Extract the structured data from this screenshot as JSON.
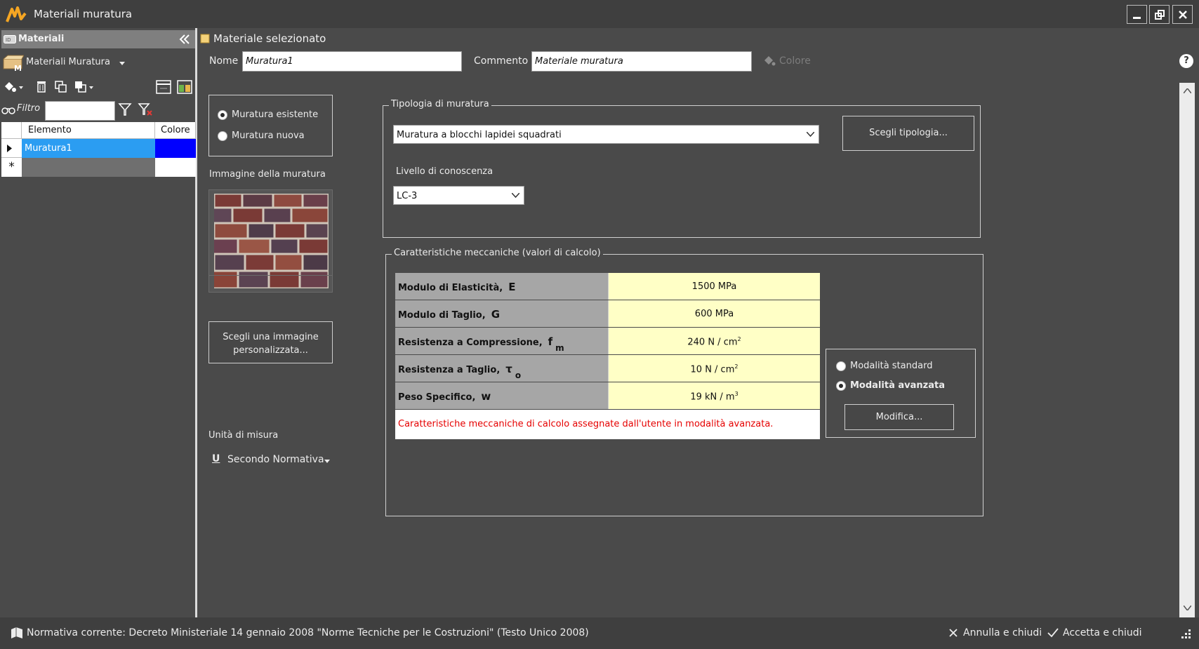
{
  "window": {
    "title": "Materiali muratura"
  },
  "left_panel": {
    "header": "Materiali",
    "library_label": "Materiali Muratura",
    "filter_label": "Filtro",
    "filter_value": "",
    "grid": {
      "columns": [
        "Elemento",
        "Colore"
      ],
      "rows": [
        {
          "name": "Muratura1",
          "color": "#0000ff"
        }
      ],
      "new_row_marker": "*"
    }
  },
  "main": {
    "section_title": "Materiale selezionato",
    "name_label": "Nome",
    "name_value": "Muratura1",
    "comment_label": "Commento",
    "comment_value": "Materiale muratura",
    "color_label": "Colore",
    "help_label": "?",
    "masonry_options": [
      {
        "label": "Muratura esistente",
        "checked": true
      },
      {
        "label": "Muratura nuova",
        "checked": false
      }
    ],
    "image_label": "Immagine della muratura",
    "custom_image_button": "Scegli una immagine personalizzata...",
    "units_label": "Unità di misura",
    "units_icon": "U",
    "units_value": "Secondo Normativa",
    "tipologia": {
      "group_title": "Tipologia di muratura",
      "selected": "Muratura a blocchi lapidei squadrati",
      "choose_button": "Scegli tipologia...",
      "knowledge_label": "Livello di conoscenza",
      "knowledge_value": "LC-3"
    },
    "mechanical": {
      "group_title": "Caratteristiche meccaniche (valori di calcolo)",
      "rows": [
        {
          "name": "Modulo di Elasticità,",
          "symbol": "E",
          "sub": "",
          "value": "1500 MPa",
          "unit_sup": ""
        },
        {
          "name": "Modulo di Taglio,",
          "symbol": "G",
          "sub": "",
          "value": "600 MPa",
          "unit_sup": ""
        },
        {
          "name": "Resistenza a Compressione,",
          "symbol": "f",
          "sub": "m",
          "value": "240 N / cm",
          "unit_sup": "2"
        },
        {
          "name": "Resistenza a Taglio,",
          "symbol": "τ",
          "sub": "o",
          "value": "10 N / cm",
          "unit_sup": "2"
        },
        {
          "name": "Peso Specifico,",
          "symbol": "w",
          "sub": "",
          "value": "19 kN / m",
          "unit_sup": "3"
        }
      ],
      "note": "Caratteristiche meccaniche di calcolo assegnate dall'utente in modalità avanzata.",
      "modes": [
        {
          "label": "Modalità standard",
          "checked": false
        },
        {
          "label": "Modalità avanzata",
          "checked": true
        }
      ],
      "modify_button": "Modifica..."
    }
  },
  "status": {
    "normativa": "Normativa corrente:  Decreto Ministeriale 14 gennaio 2008 \"Norme Tecniche per le Costruzioni\" (Testo Unico 2008)",
    "cancel_label": "Annulla e chiudi",
    "accept_label": "Accetta e chiudi"
  }
}
